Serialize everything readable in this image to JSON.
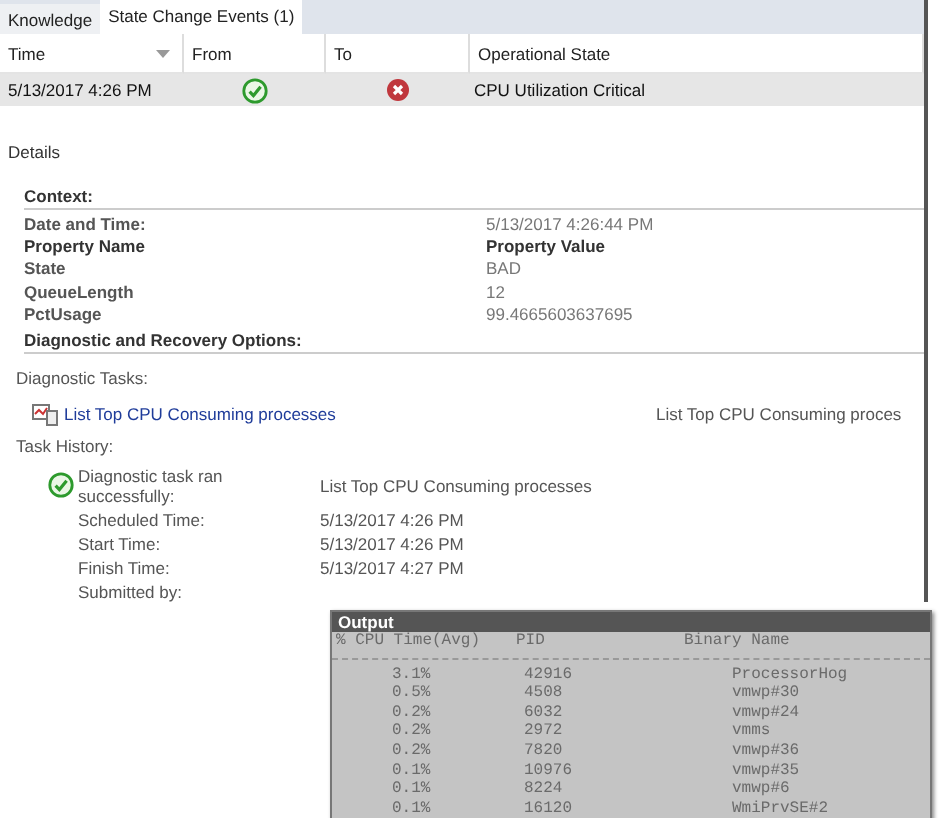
{
  "tabs": [
    {
      "label": "Knowledge",
      "selected": false
    },
    {
      "label": "State Change Events (1)",
      "selected": true
    }
  ],
  "table": {
    "columns": [
      {
        "label": "Time",
        "sorted": true
      },
      {
        "label": "From",
        "sorted": false
      },
      {
        "label": "To",
        "sorted": false
      },
      {
        "label": "Operational State",
        "sorted": false
      }
    ],
    "rows": [
      {
        "time": "5/13/2017 4:26 PM",
        "from": {
          "kind": "ok"
        },
        "to": {
          "kind": "critical"
        },
        "state": "CPU Utilization Critical",
        "selected": true
      }
    ]
  },
  "details": {
    "title": "Details",
    "context_title": "Context:",
    "date_label": "Date and Time:",
    "date_value": "5/13/2017 4:26:44 PM",
    "property_header": {
      "name": "Property Name",
      "value": "Property Value"
    },
    "properties": [
      {
        "name": "State",
        "value": "BAD"
      },
      {
        "name": "QueueLength",
        "value": "12"
      },
      {
        "name": "PctUsage",
        "value": "99.4665603637695"
      }
    ],
    "diagnostic_title": "Diagnostic and Recovery Options:",
    "tasks_label": "Diagnostic Tasks:",
    "tasks": [
      {
        "name": "List Top CPU Consuming processes",
        "column_2": "List Top CPU Consuming proces"
      }
    ],
    "history_label": "Task History:",
    "history": [
      {
        "kind": "ok",
        "message": "Diagnostic task ran successfully:",
        "value": "List Top CPU Consuming processes",
        "fields": [
          {
            "label": "Scheduled Time:",
            "value": "5/13/2017 4:26 PM"
          },
          {
            "label": "Start Time:",
            "value": "5/13/2017 4:26 PM"
          },
          {
            "label": "Finish Time:",
            "value": "5/13/2017 4:27 PM"
          },
          {
            "label": "Submitted by:"
          }
        ]
      }
    ]
  },
  "output": {
    "title": "Output",
    "columns": [
      "% CPU Time(Avg)",
      "PID",
      "Binary Name"
    ],
    "rows": [
      [
        "3.1%",
        "42916",
        "ProcessorHog"
      ],
      [
        "0.5%",
        "4508",
        "vmwp#30"
      ],
      [
        "0.2%",
        "6032",
        "vmwp#24"
      ],
      [
        "0.2%",
        "2972",
        "vmms"
      ],
      [
        "0.2%",
        "7820",
        "vmwp#36"
      ],
      [
        "0.1%",
        "10976",
        "vmwp#35"
      ],
      [
        "0.1%",
        "8224",
        "vmwp#6"
      ],
      [
        "0.1%",
        "16120",
        "WmiPrvSE#2"
      ]
    ]
  }
}
